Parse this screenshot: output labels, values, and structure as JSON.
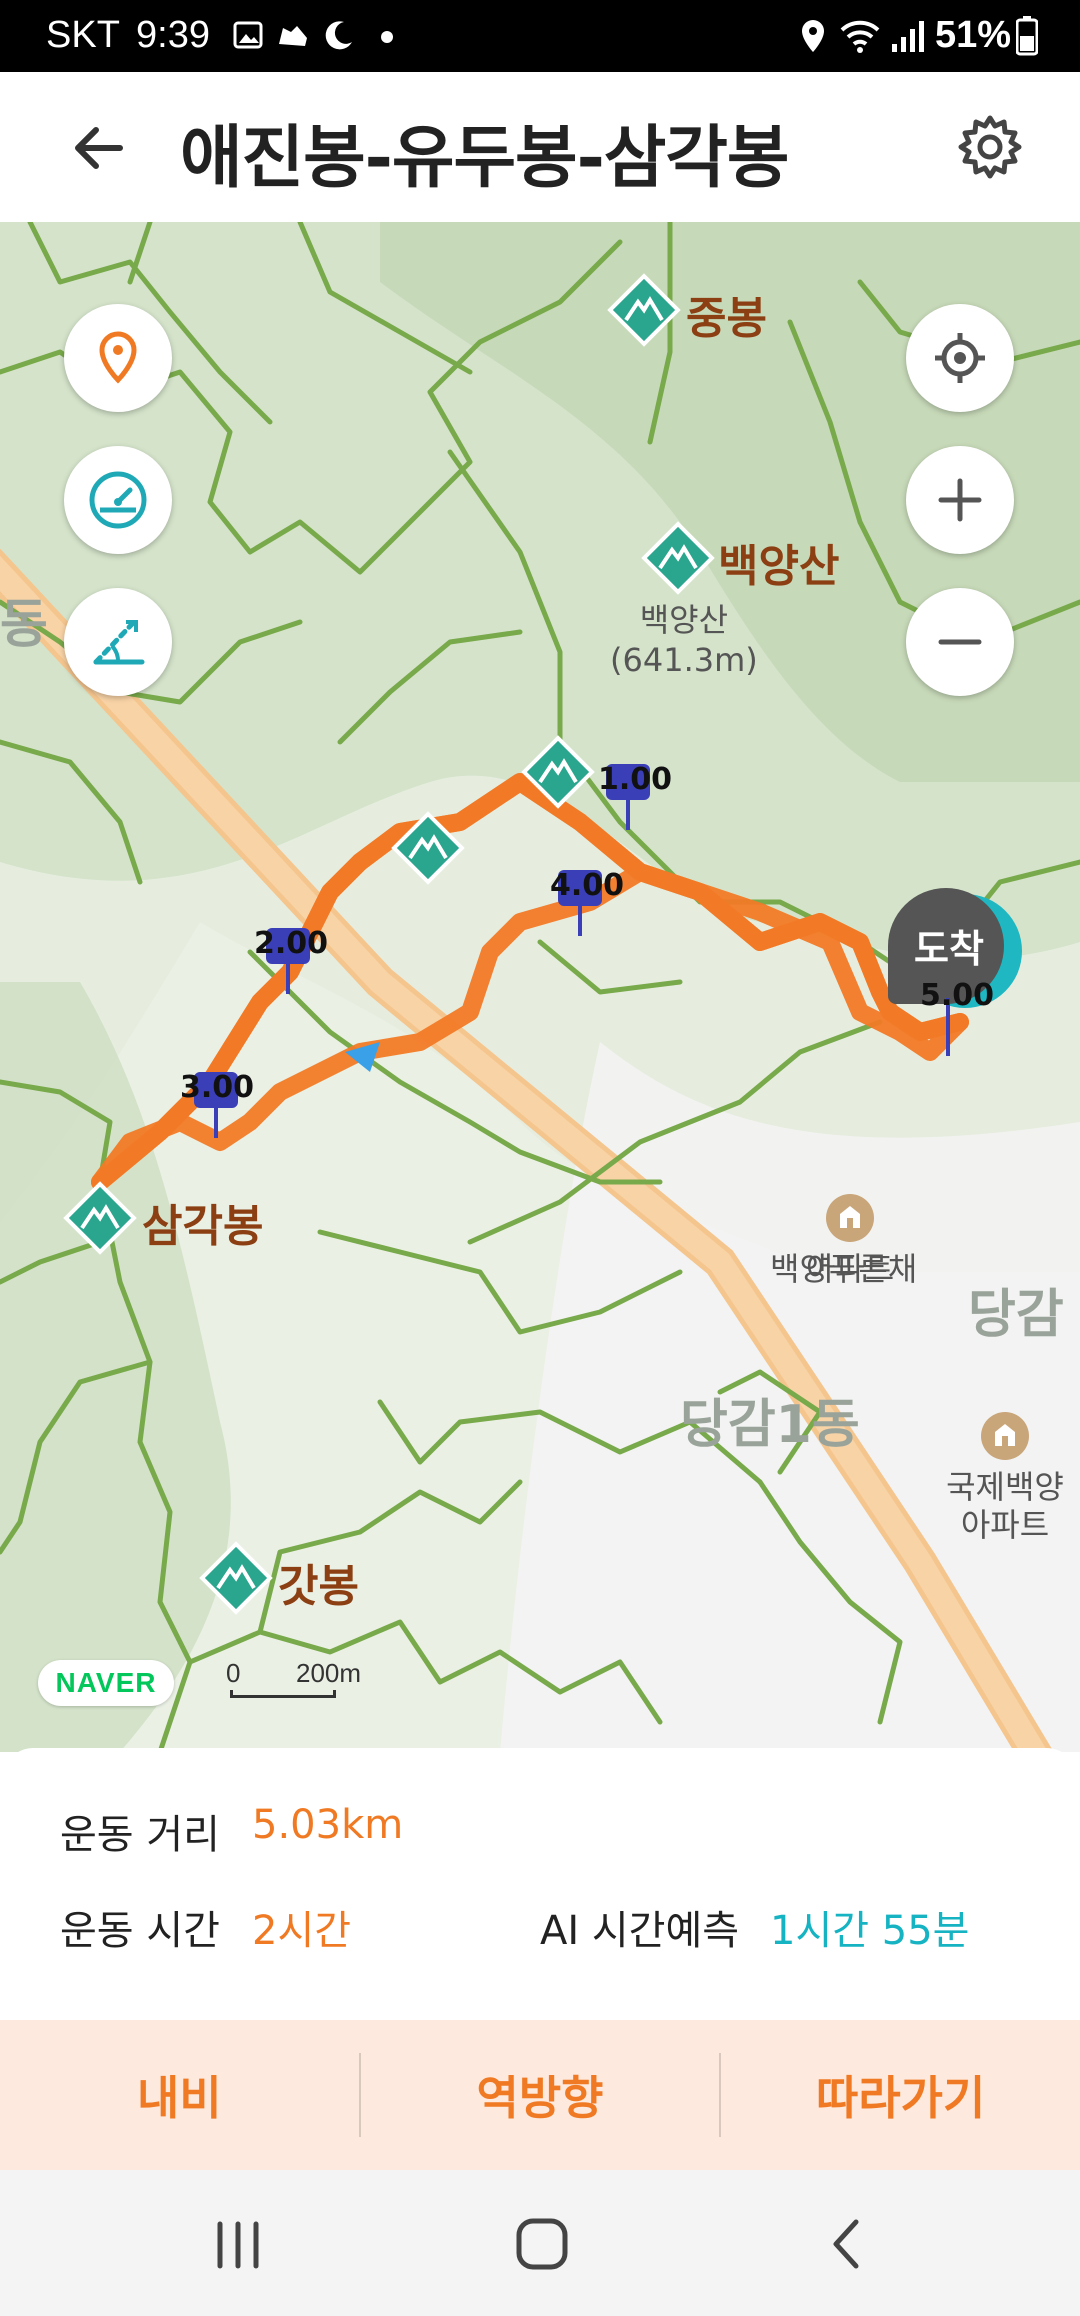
{
  "status_bar": {
    "carrier": "SKT",
    "time": "9:39",
    "battery": "51%"
  },
  "header": {
    "title": "애진봉-유두봉-삼각봉"
  },
  "map": {
    "peaks": [
      {
        "label": "중봉"
      },
      {
        "label": "백양산"
      },
      {
        "label": "삼각봉"
      },
      {
        "label": "갓봉"
      }
    ],
    "peak_subtitle": {
      "name": "백양산",
      "elevation": "(641.3m)"
    },
    "place_labels": {
      "dong1": "동",
      "danggam1": "당감1동",
      "danggam_partial": "당감"
    },
    "pois": [
      {
        "line1": "백양푸른채",
        "line2": "아파트"
      },
      {
        "line1": "국제백양",
        "line2": "아파트"
      }
    ],
    "km_markers": [
      "1.00",
      "2.00",
      "3.00",
      "4.00",
      "5.00"
    ],
    "arrival_badge": "도착",
    "scale": {
      "zero": "0",
      "distance": "200m"
    },
    "brand": "NAVER"
  },
  "stats": {
    "distance_label": "운동 거리",
    "distance_value": "5.03km",
    "time_label": "운동 시간",
    "time_value": "2시간",
    "ai_label": "AI 시간예측",
    "ai_value": "1시간 55분"
  },
  "actions": {
    "navi": "내비",
    "reverse": "역방향",
    "follow": "따라가기"
  },
  "colors": {
    "accent_orange": "#f07a24",
    "ai_teal": "#16b3c3",
    "peak_teal": "#2aa58e"
  }
}
